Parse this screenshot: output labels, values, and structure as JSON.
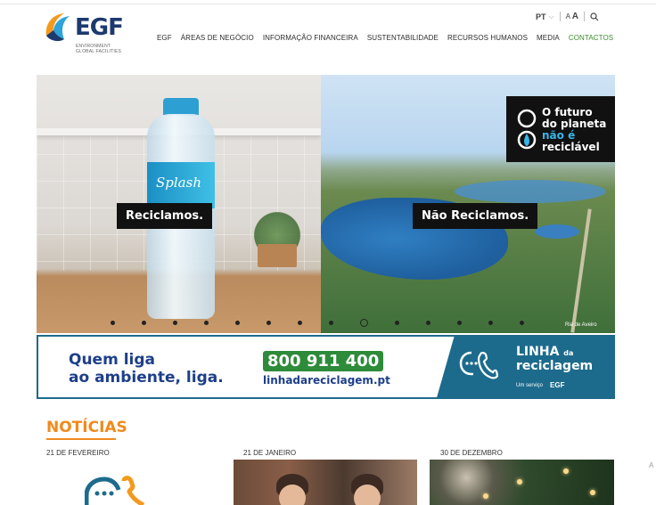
{
  "header": {
    "logo_text": "EGF",
    "logo_sub_1": "ENVIRONMENT",
    "logo_sub_2": "GLOBAL FACILITIES",
    "lang": "PT",
    "font_small": "A",
    "font_large": "A",
    "nav": [
      "EGF",
      "ÁREAS DE NEGÓCIO",
      "INFORMAÇÃO FINANCEIRA",
      "SUSTENTABILIDADE",
      "RECURSOS HUMANOS",
      "MEDIA",
      "CONTACTOS"
    ]
  },
  "hero": {
    "product": "Splash",
    "tag_left": "Reciclamos.",
    "tag_right": "Não Reciclamos.",
    "future_lines": [
      "O futuro",
      "do planeta",
      "não é",
      "reciclável"
    ],
    "credit": "Ria de Aveiro",
    "slides": 14,
    "active_slide": 9
  },
  "banner": {
    "lead_1": "Quem liga",
    "lead_2": "ao ambiente, liga.",
    "phone": "800 911 400",
    "url": "linhadareciclagem.pt",
    "brand_1": "LINHA",
    "brand_da": "da",
    "brand_2": "reciclagem",
    "service": "Um serviço",
    "service_brand": "EGF"
  },
  "news": {
    "title": "NOTÍCIAS",
    "items": [
      {
        "date": "21 DE FEVEREIRO"
      },
      {
        "date": "21 DE JANEIRO"
      },
      {
        "date": "30 DE DEZEMBRO"
      }
    ]
  },
  "edge_letter": "A",
  "colors": {
    "brand_blue": "#1d3a6e",
    "accent_green": "#3a8f2a",
    "news_orange": "#f08a1c",
    "banner_teal": "#1d6b8c"
  }
}
